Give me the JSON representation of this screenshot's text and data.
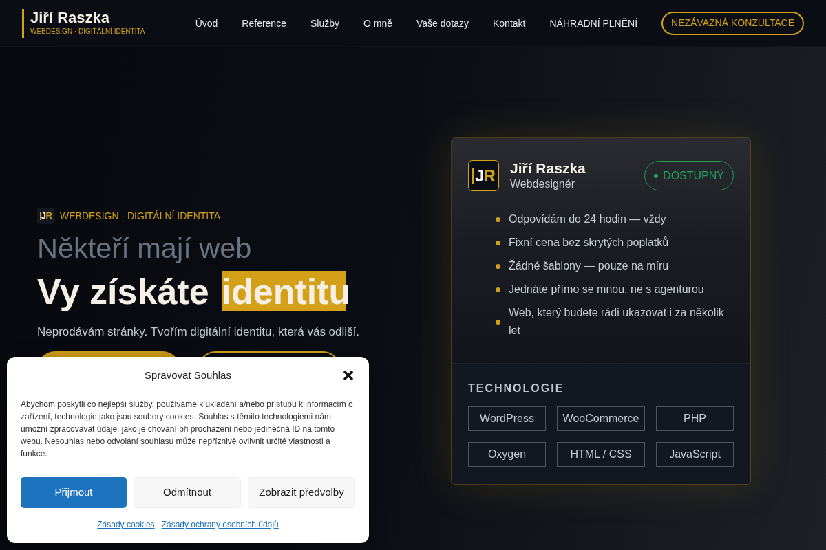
{
  "header": {
    "logo": {
      "name": "Jiří Raszka",
      "tagline": "WEBDESIGN · DIGITÁLNÍ IDENTITA"
    },
    "nav": [
      {
        "label": "Úvod"
      },
      {
        "label": "Reference"
      },
      {
        "label": "Služby"
      },
      {
        "label": "O mně"
      },
      {
        "label": "Vaše dotazy"
      },
      {
        "label": "Kontakt"
      },
      {
        "label": "NÁHRADNÍ PLNĚNÍ"
      }
    ],
    "cta": "NEZÁVAZNÁ KONZULTACE"
  },
  "hero": {
    "eyebrow": {
      "monogram": {
        "first": "J",
        "second": "R"
      },
      "text": "WEBDESIGN · DIGITÁLNÍ IDENTITA"
    },
    "title_line_1": "Někteří mají web",
    "title_line_2": {
      "text": "Vy získáte",
      "highlight": "identitu"
    },
    "subtitle": "Neprodávám stránky. Tvořím digitální identitu, která vás odliší.",
    "buttons": [
      {
        "kind": "primary"
      },
      {
        "kind": "outline"
      }
    ]
  },
  "profile_card": {
    "monogram": {
      "first": "J",
      "second": "R"
    },
    "name": "Jiří Raszka",
    "role": "Webdesignér",
    "status": "DOSTUPNÝ",
    "features": [
      "Odpovídám do 24 hodin — vždy",
      "Fixní cena bez skrytých poplatků",
      "Žádné šablony — pouze na míru",
      "Jednáte přímo se mnou, ne s agenturou",
      "Web, který budete rádi ukazovat i za několik let"
    ],
    "tech_heading": "TECHNOLOGIE",
    "technologies": [
      "WordPress",
      "WooCommerce",
      "PHP",
      "Oxygen",
      "HTML / CSS",
      "JavaScript"
    ]
  },
  "cookie_dialog": {
    "title": "Spravovat Souhlas",
    "body": "Abychom poskytli co nejlepší služby, používáme k ukládání a/nebo přístupu k informacím o zařízení, technologie jako jsou soubory cookies. Souhlas s těmito technologiemi nám umožní zpracovávat údaje, jako je chování při procházení nebo jedinečná ID na tomto webu. Nesouhlas nebo odvolání souhlasu může nepříznivě ovlivnit určité vlastnosti a funkce.",
    "buttons": [
      {
        "label": "Přijmout",
        "kind": "primary"
      },
      {
        "label": "Odmítnout",
        "kind": "secondary"
      },
      {
        "label": "Zobrazit předvolby",
        "kind": "secondary"
      }
    ],
    "links": [
      "Zásady cookies",
      "Zásady ochrany osobních údajů"
    ]
  }
}
